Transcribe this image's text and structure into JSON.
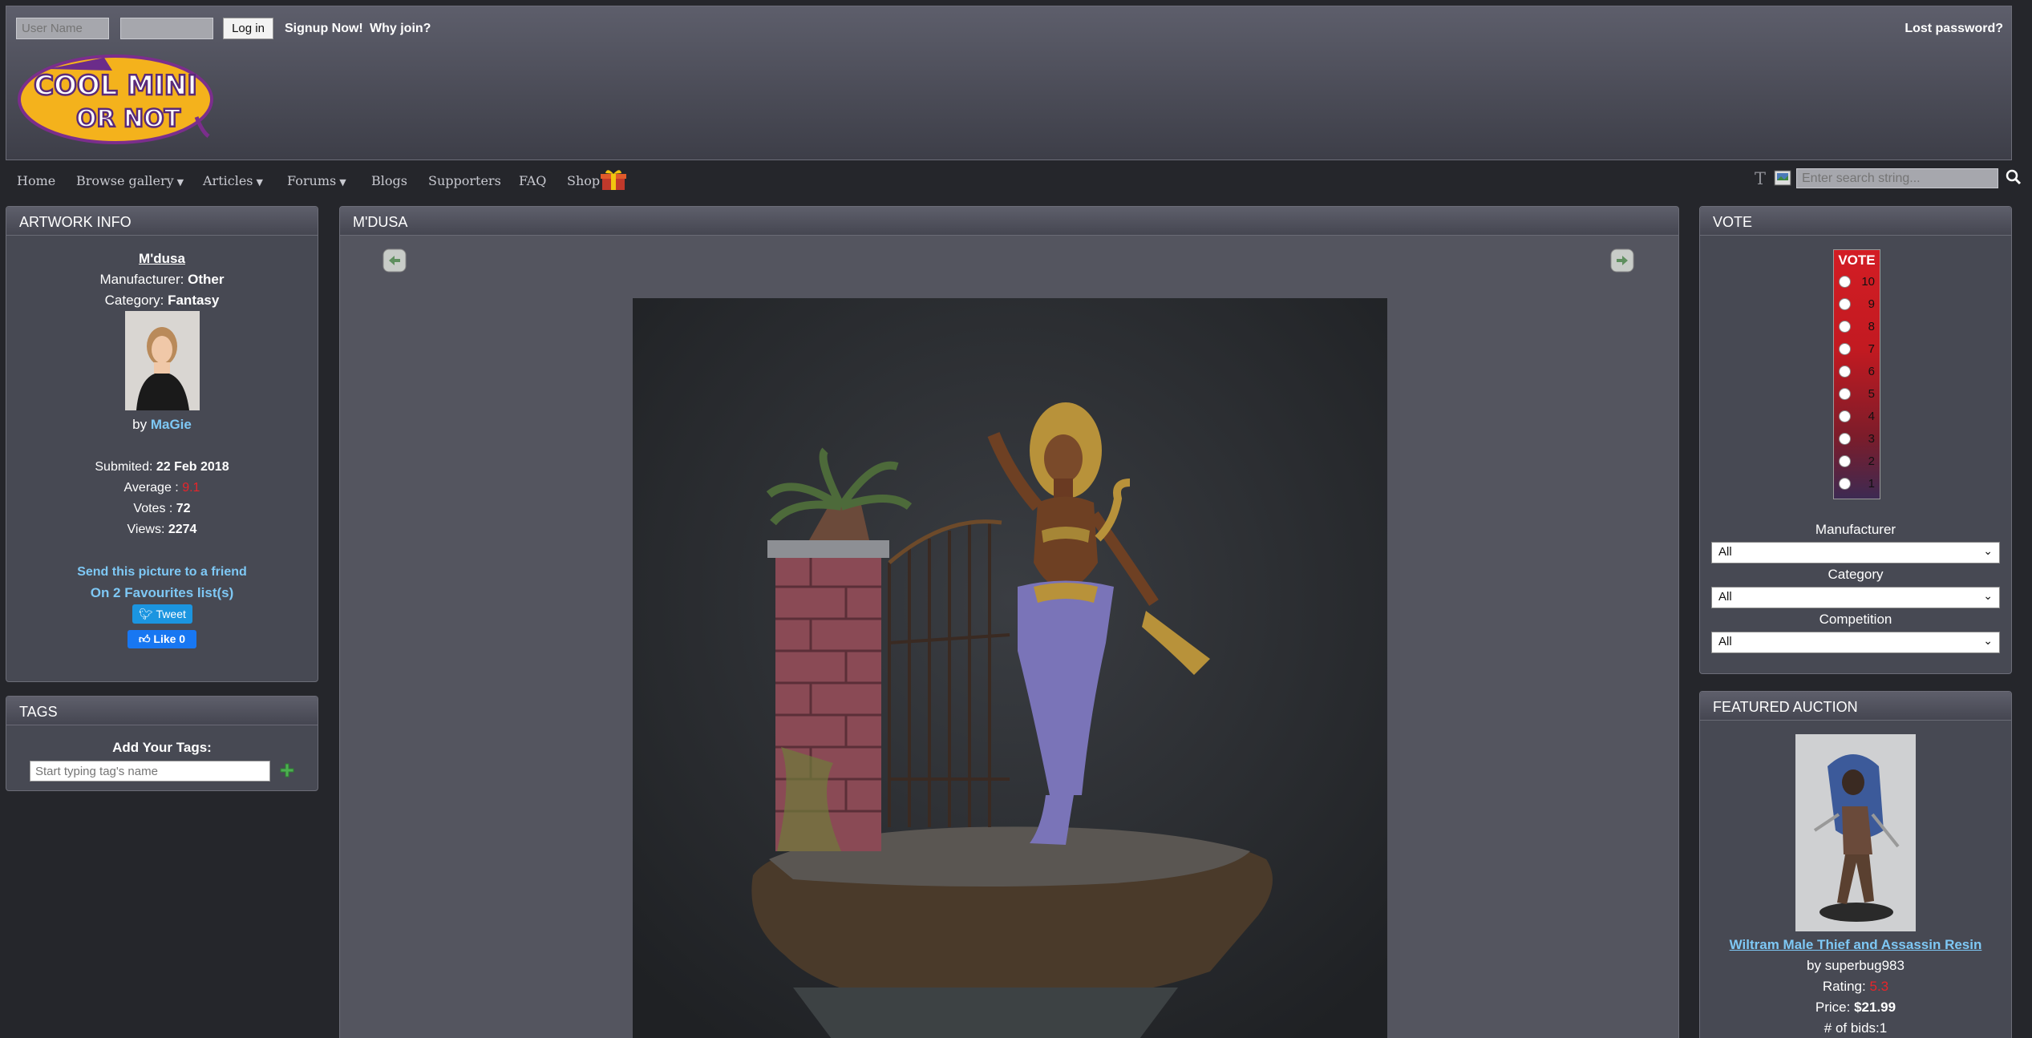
{
  "login": {
    "username_placeholder": "User Name",
    "password_placeholder": "",
    "login_label": "Log in",
    "signup_label": "Signup Now!",
    "why_join_label": "Why join?",
    "lost_password_label": "Lost password?"
  },
  "logo": {
    "line1": "COOL MINI",
    "line2": "OR NOT"
  },
  "nav": {
    "items": [
      {
        "label": "Home"
      },
      {
        "label": "Browse gallery"
      },
      {
        "label": "Articles"
      },
      {
        "label": "Forums"
      },
      {
        "label": "Blogs"
      },
      {
        "label": "Supporters"
      },
      {
        "label": "FAQ"
      },
      {
        "label": "Shop"
      }
    ],
    "text_size_glyph": "T",
    "search_placeholder": "Enter search string..."
  },
  "artwork_info": {
    "title": "ARTWORK INFO",
    "name": "M'dusa",
    "manufacturer_label": "Manufacturer:",
    "manufacturer": "Other",
    "category_label": "Category:",
    "category": "Fantasy",
    "by_label": "by",
    "author": "MaGie",
    "submitted_label": "Submited:",
    "submitted": "22 Feb 2018",
    "average_label": "Average :",
    "average": "9.1",
    "votes_label": "Votes :",
    "votes": "72",
    "views_label": "Views:",
    "views": "2274",
    "send_friend": "Send this picture to a friend",
    "favourites": "On 2 Favourites list(s)",
    "tweet": "Tweet",
    "like": "Like 0"
  },
  "tags": {
    "title": "TAGS",
    "add_label": "Add Your Tags:",
    "input_placeholder": "Start typing tag's name"
  },
  "main": {
    "title": "M'DUSA"
  },
  "vote": {
    "title": "VOTE",
    "box_label": "VOTE",
    "options": [
      "10",
      "9",
      "8",
      "7",
      "6",
      "5",
      "4",
      "3",
      "2",
      "1"
    ],
    "manufacturer_label": "Manufacturer",
    "manufacturer_value": "All",
    "category_label": "Category",
    "category_value": "All",
    "competition_label": "Competition",
    "competition_value": "All"
  },
  "auction": {
    "title": "FEATURED AUCTION",
    "item": "Wiltram Male Thief and Assassin Resin",
    "by_label": "by",
    "seller": "superbug983",
    "rating_label": "Rating:",
    "rating": "5.3",
    "price_label": "Price:",
    "price": "$21.99",
    "bids_label": "# of bids:",
    "bids": "1"
  },
  "colors": {
    "background": "#25262b",
    "panel": "#474953",
    "link_blue": "#7ec8f5",
    "rating_red": "#e8242a",
    "vote_red": "#d31d24"
  }
}
